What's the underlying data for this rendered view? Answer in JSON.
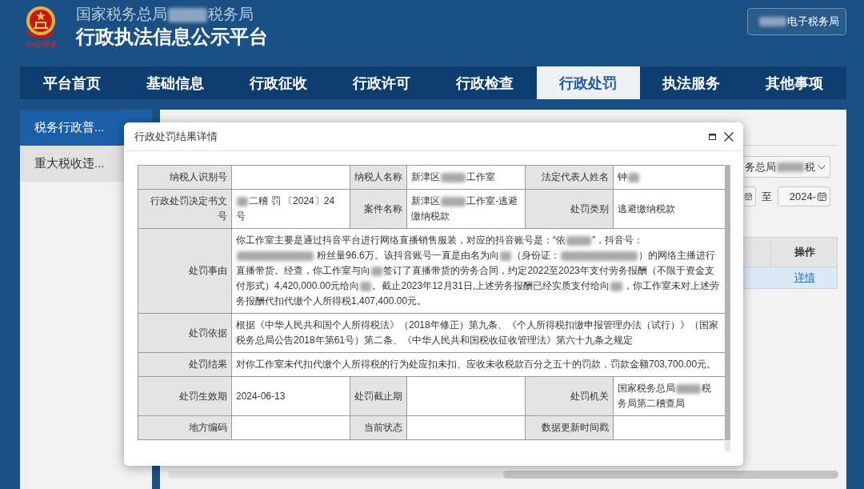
{
  "header": {
    "logo_caption": "中国税务",
    "subtitle": [
      {
        "kind": "text",
        "text": "国家税务总局"
      },
      {
        "kind": "redacted"
      },
      {
        "kind": "text",
        "text": "税务局"
      }
    ],
    "title": "行政执法信息公示平台",
    "portal_button": [
      {
        "kind": "redacted"
      },
      {
        "kind": "text",
        "text": "电子税务局"
      }
    ]
  },
  "nav": [
    {
      "label": "平台首页",
      "selected": false
    },
    {
      "label": "基础信息",
      "selected": false
    },
    {
      "label": "行政征收",
      "selected": false
    },
    {
      "label": "行政许可",
      "selected": false
    },
    {
      "label": "行政检查",
      "selected": false
    },
    {
      "label": "行政处罚",
      "selected": true
    },
    {
      "label": "执法服务",
      "selected": false
    },
    {
      "label": "其他事项",
      "selected": false
    }
  ],
  "sidebar": {
    "items": [
      {
        "label": "税务行政普...",
        "selected": true
      },
      {
        "label": "重大税收违...",
        "selected": false
      }
    ]
  },
  "query_panel": {
    "authority_select": [
      {
        "kind": "text",
        "text": "务总局"
      },
      {
        "kind": "redacted"
      },
      {
        "kind": "text",
        "text": "税"
      }
    ],
    "date_separator": "至",
    "date_to": "2024-",
    "results_table": {
      "columns": [
        "操作"
      ],
      "rows": [
        {
          "action": "详情",
          "selected": true
        }
      ]
    }
  },
  "dialog": {
    "title": "行政处罚结果详情",
    "rows": [
      {
        "kind": "pairs",
        "fields": [
          {
            "label": "纳税人识别号"
          },
          {
            "label": "纳税人名称",
            "value": [
              {
                "kind": "text",
                "text": "新津区"
              },
              {
                "kind": "redacted"
              },
              {
                "kind": "text",
                "text": "工作室"
              }
            ]
          },
          {
            "label": "法定代表人姓名",
            "value": [
              {
                "kind": "text",
                "text": "钟"
              },
              {
                "kind": "redacted_short"
              }
            ]
          }
        ]
      },
      {
        "kind": "pairs",
        "fields": [
          {
            "label": "行政处罚决定书文号",
            "value": [
              {
                "kind": "redacted_short"
              },
              {
                "kind": "text",
                "text": "二稽 罚 〔2024〕24 号"
              }
            ]
          },
          {
            "label": "案件名称",
            "value": [
              {
                "kind": "text",
                "text": "新津区"
              },
              {
                "kind": "redacted"
              },
              {
                "kind": "text",
                "text": "工作室-逃避缴纳税款"
              }
            ]
          },
          {
            "label": "处罚类别",
            "value": "逃避缴纳税款"
          }
        ]
      },
      {
        "kind": "wide",
        "label": "处罚事由",
        "value": [
          {
            "kind": "text",
            "text": "你工作室主要是通过抖音平台进行网络直播销售服装，对应的抖音账号是：“依"
          },
          {
            "kind": "redacted"
          },
          {
            "kind": "text",
            "text": "”，抖音号："
          },
          {
            "kind": "redacted_long"
          },
          {
            "kind": "text",
            "text": " 粉丝量96.6万。该抖音账号一直是由名为向"
          },
          {
            "kind": "redacted_short"
          },
          {
            "kind": "text",
            "text": "（身份证："
          },
          {
            "kind": "redacted_long"
          },
          {
            "kind": "text",
            "text": "）的网络主播进行直播带货。经查，你工作室与向"
          },
          {
            "kind": "redacted_short"
          },
          {
            "kind": "text",
            "text": "签订了直播带货的劳务合同，约定2022至2023年支付劳务报酬（不限于资金支付形式）4,420,000.00元给向"
          },
          {
            "kind": "redacted_short"
          },
          {
            "kind": "text",
            "text": "。截止2023年12月31日,上述劳务报酬已经实质支付给向"
          },
          {
            "kind": "redacted_short"
          },
          {
            "kind": "text",
            "text": "，你工作室未对上述劳务报酬代扣代缴个人所得税1,407,400.00元。"
          }
        ]
      },
      {
        "kind": "wide",
        "label": "处罚依据",
        "value": "根据《中华人民共和国个人所得税法》（2018年修正）第九条、《个人所得税扣缴申报管理办法（试行）》（国家税务总局公告2018年第61号）第二条、《中华人民共和国税收征收管理法》第六十九条之规定"
      },
      {
        "kind": "wide",
        "label": "处罚结果",
        "value": "对你工作室未代扣代缴个人所得税的行为处应扣未扣、应收未收税款百分之五十的罚款，罚款金额703,700.00元。"
      },
      {
        "kind": "pairs",
        "fields": [
          {
            "label": "处罚生效期",
            "value": "2024-06-13"
          },
          {
            "label": "处罚截止期"
          },
          {
            "label": "处罚机关",
            "value": [
              {
                "kind": "text",
                "text": "国家税务总局"
              },
              {
                "kind": "redacted"
              },
              {
                "kind": "text",
                "text": "税务局第二稽查局"
              }
            ]
          }
        ]
      },
      {
        "kind": "pairs",
        "fields": [
          {
            "label": "地方编码"
          },
          {
            "label": "当前状态"
          },
          {
            "label": "数据更新时间戳"
          }
        ]
      }
    ]
  }
}
